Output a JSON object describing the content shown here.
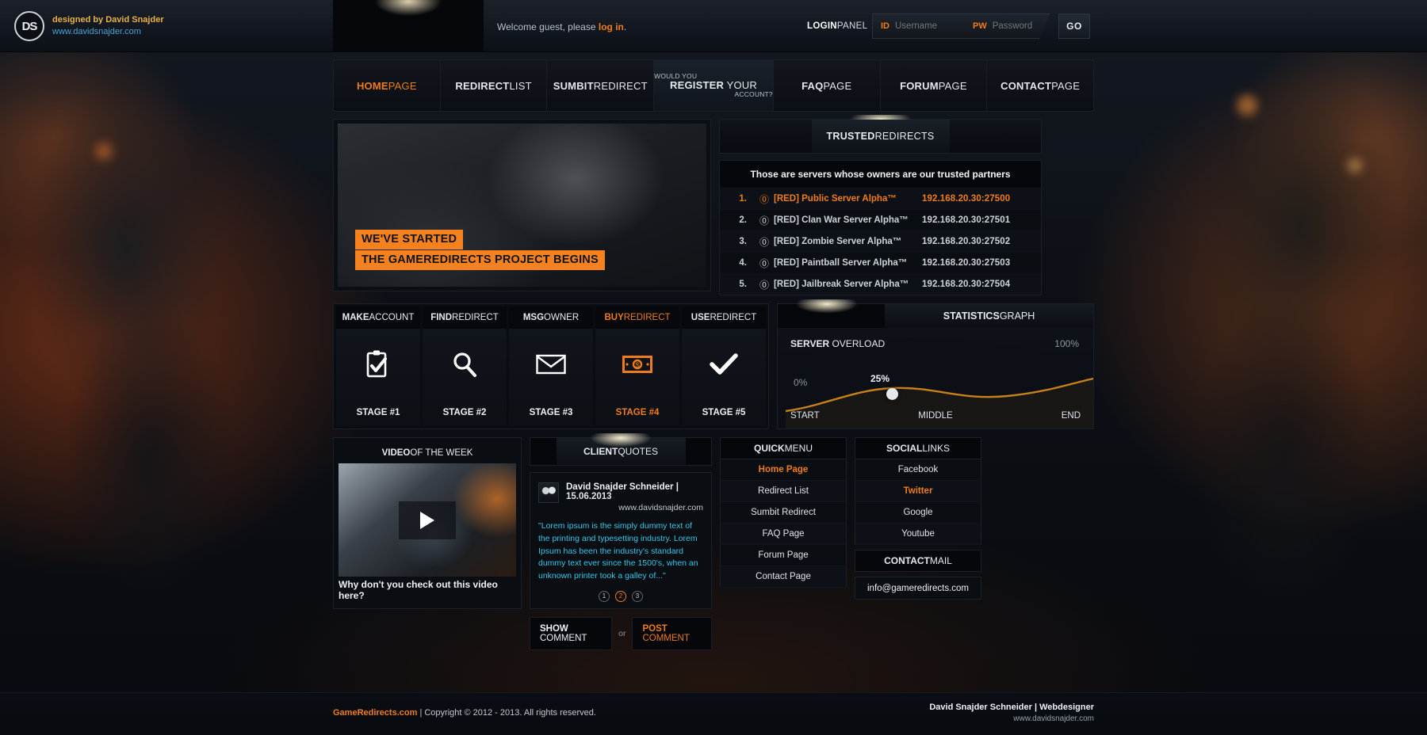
{
  "brand": {
    "logo_text": "DS",
    "designed_by": "designed by David Snajder",
    "website": "www.davidsnajder.com"
  },
  "topbar": {
    "welcome_prefix": "Welcome guest, please ",
    "welcome_link": "log in",
    "welcome_suffix": ".",
    "login_panel_bold": "LOGIN",
    "login_panel_rest": "PANEL",
    "login_panel_arrow": ">",
    "id_tag": "ID",
    "id_placeholder": "Username",
    "pw_tag": "PW",
    "pw_placeholder": "Password",
    "go_label": "GO"
  },
  "nav": [
    {
      "bold": "HOME",
      "rest": " PAGE",
      "active": true
    },
    {
      "bold": "REDIRECT",
      "rest": " LIST",
      "active": false
    },
    {
      "bold": "SUMBIT",
      "rest": " REDIRECT",
      "active": false
    },
    {
      "bold": "REGISTER",
      "rest": " YOUR",
      "active": false,
      "pre": "WOULD YOU",
      "post": "ACCOUNT?",
      "register": true
    },
    {
      "bold": "FAQ",
      "rest": " PAGE",
      "active": false
    },
    {
      "bold": "FORUM",
      "rest": " PAGE",
      "active": false
    },
    {
      "bold": "CONTACT",
      "rest": " PAGE",
      "active": false
    }
  ],
  "hero": {
    "caption_line1": "WE'VE STARTED",
    "caption_line2": "THE GAMEREDIRECTS PROJECT BEGINS"
  },
  "trusted": {
    "tab_bold": "TRUSTED",
    "tab_rest": " REDIRECTS",
    "subtitle": "Those are servers whose owners are our trusted partners",
    "rows": [
      {
        "index": "1.",
        "name": "[RED] Public Server Alpha™",
        "ip": "192.168.20.30:27500",
        "highlight": true
      },
      {
        "index": "2.",
        "name": "[RED] Clan War Server Alpha™",
        "ip": "192.168.20.30:27501",
        "highlight": false
      },
      {
        "index": "3.",
        "name": "[RED] Zombie Server Alpha™",
        "ip": "192.168.20.30:27502",
        "highlight": false
      },
      {
        "index": "4.",
        "name": "[RED] Paintball Server Alpha™",
        "ip": "192.168.20.30:27503",
        "highlight": false
      },
      {
        "index": "5.",
        "name": "[RED] Jailbreak Server Alpha™",
        "ip": "192.168.20.30:27504",
        "highlight": false
      }
    ]
  },
  "stages": [
    {
      "title_bold": "MAKE",
      "title_rest": " ACCOUNT",
      "icon": "clipboard-check-icon",
      "foot": "STAGE #1",
      "active": false
    },
    {
      "title_bold": "FIND",
      "title_rest": " REDIRECT",
      "icon": "magnifier-icon",
      "foot": "STAGE #2",
      "active": false
    },
    {
      "title_bold": "MSG",
      "title_rest": " OWNER",
      "icon": "envelope-icon",
      "foot": "STAGE #3",
      "active": false
    },
    {
      "title_bold": "BUY",
      "title_rest": " REDIRECT",
      "icon": "banknote-icon",
      "foot": "STAGE #4",
      "active": true
    },
    {
      "title_bold": "USE",
      "title_rest": " REDIRECT",
      "icon": "checkmark-icon",
      "foot": "STAGE #5",
      "active": false
    }
  ],
  "stats": {
    "tab_bold": "STATISTICS",
    "tab_rest": " GRAPH",
    "series_label_bold": "SERVER",
    "series_label_rest": " OVERLOAD",
    "max_label": "100%",
    "min_label": "0%",
    "point_label": "25%",
    "axis_start": "START",
    "axis_middle": "MIDDLE",
    "axis_end": "END",
    "accent": "#c8801a"
  },
  "chart_data": {
    "type": "line",
    "title": "SERVER OVERLOAD",
    "categories": [
      "START",
      "MIDDLE",
      "END"
    ],
    "x": [
      0,
      50,
      100
    ],
    "values": [
      0,
      25,
      18
    ],
    "ylim": [
      0,
      100
    ],
    "ylabel": "%",
    "annotations": [
      "0%",
      "25%",
      "100%"
    ],
    "grid": false,
    "legend": "none",
    "marker_at": "MIDDLE"
  },
  "video": {
    "head_bold": "VIDEO",
    "head_rest": " OF THE WEEK",
    "play_icon": "play-icon",
    "foot": "Why don't you check out this video here?"
  },
  "quotes": {
    "tab_bold": "CLIENT",
    "tab_rest": " QUOTES",
    "author": "David Snajder Schneider",
    "separator": " | ",
    "date": "15.06.2013",
    "site": "www.davidsnajder.com",
    "text": "\"Lorem ipsum is the simply dummy text of the printing and typesetting industry. Lorem Ipsum has been the industry's standard dummy text ever since the 1500's, when an unknown printer took a galley of...\"",
    "dots": [
      "1",
      "2",
      "3"
    ],
    "active_dot": 1,
    "show_comment_bold": "SHOW",
    "show_comment_rest": " COMMENT",
    "or": "or",
    "post_comment_bold": "POST",
    "post_comment_rest": " COMMENT"
  },
  "quick_menu": {
    "head_bold": "QUICK",
    "head_rest": " MENU",
    "items": [
      {
        "label": "Home Page",
        "active": true
      },
      {
        "label": "Redirect List",
        "active": false
      },
      {
        "label": "Sumbit Redirect",
        "active": false
      },
      {
        "label": "FAQ Page",
        "active": false
      },
      {
        "label": "Forum Page",
        "active": false
      },
      {
        "label": "Contact Page",
        "active": false
      }
    ]
  },
  "social": {
    "head_bold": "SOCIAL",
    "head_rest": " LINKS",
    "items": [
      {
        "label": "Facebook",
        "active": false
      },
      {
        "label": "Twitter",
        "active": true
      },
      {
        "label": "Google",
        "active": false
      },
      {
        "label": "Youtube",
        "active": false
      }
    ],
    "contact_head_bold": "CONTACT",
    "contact_head_rest": " MAIL",
    "email": "info@gameredirects.com"
  },
  "footer": {
    "site": "GameRedirects.com",
    "copyright": "  |  Copyright © 2012 - 2013. All rights reserved.",
    "credit": "David Snajder Schneider | Webdesigner",
    "credit_site": "www.davidsnajder.com"
  },
  "colors": {
    "accent": "#f07c1a",
    "cyan": "#35c8e8",
    "yellow": "#e8b24a",
    "blue": "#4aa3d6"
  }
}
